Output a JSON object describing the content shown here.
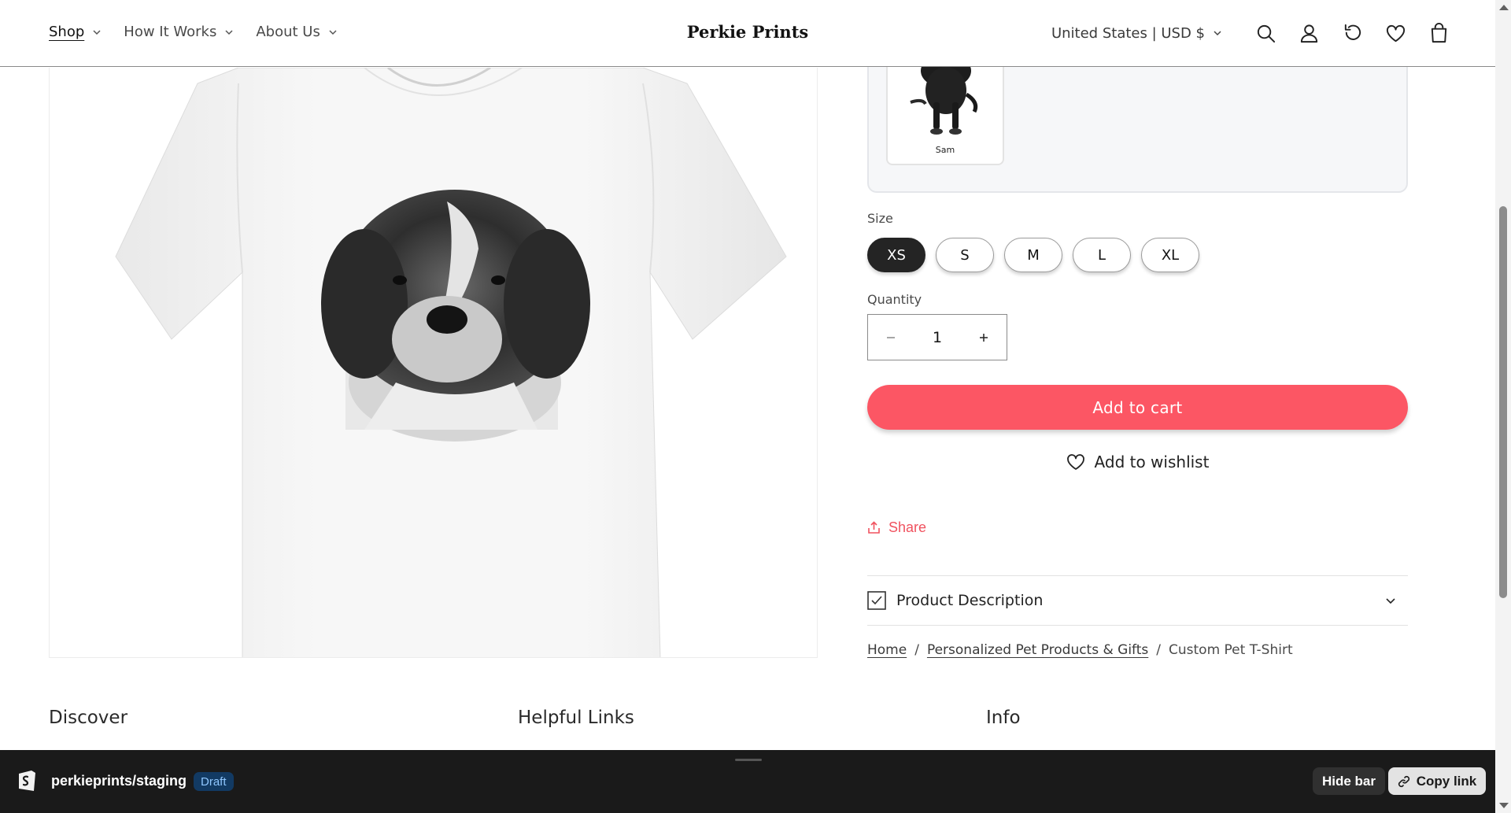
{
  "header": {
    "nav": [
      {
        "label": "Shop",
        "active": true
      },
      {
        "label": "How It Works",
        "active": false
      },
      {
        "label": "About Us",
        "active": false
      }
    ],
    "brand": "Perkie Prints",
    "currency": "United States | USD $"
  },
  "pet_selector": {
    "pets": [
      {
        "name": "Sam"
      }
    ]
  },
  "size": {
    "label": "Size",
    "options": [
      "XS",
      "S",
      "M",
      "L",
      "XL"
    ],
    "selected": "XS"
  },
  "quantity": {
    "label": "Quantity",
    "value": "1"
  },
  "actions": {
    "add_to_cart": "Add to cart",
    "add_to_wishlist": "Add to wishlist",
    "share": "Share"
  },
  "accordion": {
    "product_description": "Product Description"
  },
  "breadcrumb": [
    {
      "label": "Home",
      "link": true
    },
    {
      "label": "Personalized Pet Products & Gifts",
      "link": true
    },
    {
      "label": "Custom Pet T-Shirt",
      "link": false
    }
  ],
  "footer": {
    "headings": [
      "Discover",
      "Helpful Links",
      "Info"
    ]
  },
  "preview_bar": {
    "store": "perkieprints/staging",
    "status": "Draft",
    "hide_bar": "Hide bar",
    "copy_link": "Copy link"
  },
  "colors": {
    "accent": "#fc5664",
    "share": "#f0525f",
    "selected_size": "#242424",
    "preview_bar": "#1a1a1a",
    "draft_badge_bg": "#123a63",
    "draft_badge_text": "#8fc7ff"
  },
  "icons": [
    "search-icon",
    "account-icon",
    "reorder-icon",
    "heart-icon",
    "cart-icon",
    "chevron-down-icon",
    "minus-icon",
    "plus-icon",
    "share-icon",
    "checkbox-icon",
    "link-icon",
    "shopify-logo"
  ]
}
